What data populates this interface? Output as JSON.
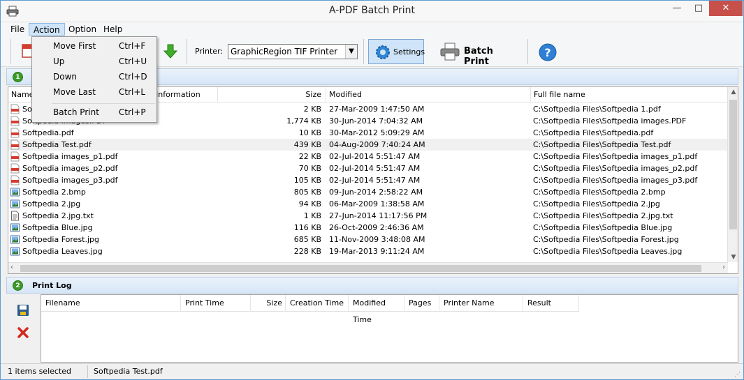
{
  "window": {
    "title": "A-PDF Batch Print"
  },
  "menubar": {
    "file": "File",
    "action": "Action",
    "option": "Option",
    "help": "Help"
  },
  "action_menu": [
    {
      "label": "Move First",
      "shortcut": "Ctrl+F"
    },
    {
      "label": "Up",
      "shortcut": "Ctrl+U"
    },
    {
      "label": "Down",
      "shortcut": "Ctrl+D"
    },
    {
      "label": "Move Last",
      "shortcut": "Ctrl+L"
    },
    {
      "label": "Batch Print",
      "shortcut": "Ctrl+P"
    }
  ],
  "toolbar": {
    "printer_label": "Printer:",
    "printer_value": "GraphicRegion TIF Printer",
    "settings_label": "Settings",
    "batch_print_label": "Batch Print"
  },
  "files_panel": {
    "columns": [
      "Name",
      "Information",
      "Size",
      "Modified",
      "Full file name"
    ],
    "rows": [
      {
        "name": "Softpedia 1.pdf",
        "size": "2 KB",
        "modified": "27-Mar-2009 1:47:50 AM",
        "full": "C:\\Softpedia Files\\Softpedia 1.pdf",
        "icon": "pdf-icon"
      },
      {
        "name": "Softpedia images.PDF",
        "size": "1,774 KB",
        "modified": "30-Jun-2014 7:04:32 AM",
        "full": "C:\\Softpedia Files\\Softpedia images.PDF",
        "icon": "pdf-icon"
      },
      {
        "name": "Softpedia.pdf",
        "size": "10 KB",
        "modified": "30-Mar-2012 5:09:29 AM",
        "full": "C:\\Softpedia Files\\Softpedia.pdf",
        "icon": "pdf-icon"
      },
      {
        "name": "Softpedia Test.pdf",
        "size": "439 KB",
        "modified": "04-Aug-2009 7:40:24 AM",
        "full": "C:\\Softpedia Files\\Softpedia Test.pdf",
        "icon": "pdf-icon",
        "selected": true
      },
      {
        "name": "Softpedia images_p1.pdf",
        "size": "22 KB",
        "modified": "02-Jul-2014 5:51:47 AM",
        "full": "C:\\Softpedia Files\\Softpedia images_p1.pdf",
        "icon": "pdf-icon"
      },
      {
        "name": "Softpedia images_p2.pdf",
        "size": "70 KB",
        "modified": "02-Jul-2014 5:51:47 AM",
        "full": "C:\\Softpedia Files\\Softpedia images_p2.pdf",
        "icon": "pdf-icon"
      },
      {
        "name": "Softpedia images_p3.pdf",
        "size": "105 KB",
        "modified": "02-Jul-2014 5:51:47 AM",
        "full": "C:\\Softpedia Files\\Softpedia images_p3.pdf",
        "icon": "pdf-icon"
      },
      {
        "name": "Softpedia 2.bmp",
        "size": "805 KB",
        "modified": "09-Jun-2014 2:58:22 AM",
        "full": "C:\\Softpedia Files\\Softpedia 2.bmp",
        "icon": "image-icon"
      },
      {
        "name": "Softpedia 2.jpg",
        "size": "94 KB",
        "modified": "06-Mar-2009 1:38:58 AM",
        "full": "C:\\Softpedia Files\\Softpedia 2.jpg",
        "icon": "image-icon"
      },
      {
        "name": "Softpedia 2.jpg.txt",
        "size": "1 KB",
        "modified": "27-Jun-2014 11:17:56 PM",
        "full": "C:\\Softpedia Files\\Softpedia 2.jpg.txt",
        "icon": "text-file-icon"
      },
      {
        "name": "Softpedia Blue.jpg",
        "size": "116 KB",
        "modified": "26-Oct-2009 2:46:36 AM",
        "full": "C:\\Softpedia Files\\Softpedia Blue.jpg",
        "icon": "image-icon"
      },
      {
        "name": "Softpedia Forest.jpg",
        "size": "685 KB",
        "modified": "11-Nov-2009 3:48:08 AM",
        "full": "C:\\Softpedia Files\\Softpedia Forest.jpg",
        "icon": "image-icon"
      },
      {
        "name": "Softpedia Leaves.jpg",
        "size": "228 KB",
        "modified": "19-Mar-2013 9:11:24 AM",
        "full": "C:\\Softpedia Files\\Softpedia Leaves.jpg",
        "icon": "image-icon"
      }
    ]
  },
  "log_panel": {
    "title": "Print Log",
    "columns": [
      "Filename",
      "Print Time",
      "Size",
      "Creation Time",
      "Modified Time",
      "Pages",
      "Printer Name",
      "Result"
    ]
  },
  "status": {
    "selected": "1 items selected",
    "file": "Softpedia Test.pdf"
  },
  "colors": {
    "accent": "#cfe4f8",
    "close": "#c7504a",
    "badge": "#3c9a28",
    "selection": "#f0f0f0"
  }
}
